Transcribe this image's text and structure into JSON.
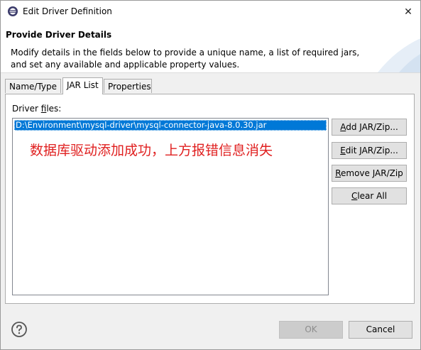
{
  "window": {
    "title": "Edit Driver Definition",
    "close_glyph": "✕"
  },
  "header": {
    "title": "Provide Driver Details",
    "description_line1": "Modify details in the fields below to provide a unique name, a list of required jars,",
    "description_line2": "and set any available and applicable property values."
  },
  "tabs": [
    {
      "label": "Name/Type",
      "active": false
    },
    {
      "label": "JAR List",
      "active": true
    },
    {
      "label": "Properties",
      "active": false
    }
  ],
  "jar_list": {
    "label_prefix": "Driver ",
    "label_mnemonic": "f",
    "label_suffix": "iles:",
    "files": [
      "D:\\Environment\\mysql-driver\\mysql-connector-java-8.0.30.jar"
    ],
    "selected_index": 0
  },
  "annotation": {
    "text": "数据库驱动添加成功，上方报错信息消失",
    "color": "#e02020"
  },
  "side_buttons": {
    "add": {
      "mnemonic": "A",
      "rest": "dd JAR/Zip..."
    },
    "edit": {
      "mnemonic": "E",
      "rest": "dit JAR/Zip..."
    },
    "remove": {
      "mnemonic": "R",
      "rest": "emove JAR/Zip"
    },
    "clear": {
      "mnemonic": "C",
      "rest": "lear All"
    }
  },
  "footer": {
    "ok_label": "OK",
    "ok_enabled": false,
    "cancel_label": "Cancel",
    "help_icon": "question-circle-icon"
  },
  "colors": {
    "selection": "#0078d7",
    "dialog_bg": "#f0f0f0"
  }
}
